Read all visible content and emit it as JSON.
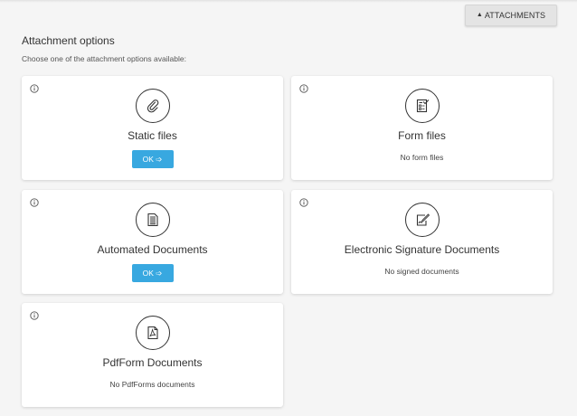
{
  "header": {
    "attachments_button": "ATTACHMENTS"
  },
  "section": {
    "title": "Attachment options",
    "subtitle": "Choose one of the attachment options available:"
  },
  "cards": [
    {
      "title": "Static files",
      "button": "OK ➩",
      "icon": "paperclip-icon"
    },
    {
      "title": "Form files",
      "status": "No form files",
      "icon": "form-icon"
    },
    {
      "title": "Automated Documents",
      "button": "OK ➩",
      "icon": "document-icon"
    },
    {
      "title": "Electronic Signature Documents",
      "status": "No signed documents",
      "icon": "signature-icon"
    },
    {
      "title": "PdfForm Documents",
      "status": "No PdfForms documents",
      "icon": "pdf-icon"
    }
  ],
  "colors": {
    "ok_button": "#38a8e0",
    "card_bg": "#ffffff",
    "page_bg": "#f5f5f5"
  }
}
